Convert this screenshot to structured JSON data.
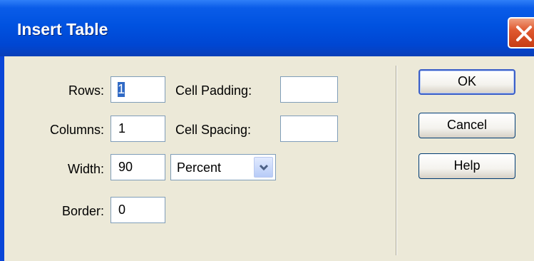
{
  "dialog": {
    "title": "Insert Table",
    "close_icon": "close-icon"
  },
  "form": {
    "rows": {
      "label": "Rows:",
      "value": "1"
    },
    "columns": {
      "label": "Columns:",
      "value": "1"
    },
    "width": {
      "label": "Width:",
      "value": "90",
      "unit": "Percent"
    },
    "border": {
      "label": "Border:",
      "value": "0"
    },
    "cell_padding": {
      "label": "Cell Padding:",
      "value": ""
    },
    "cell_spacing": {
      "label": "Cell Spacing:",
      "value": ""
    }
  },
  "buttons": {
    "ok": "OK",
    "cancel": "Cancel",
    "help": "Help"
  },
  "colors": {
    "titlebar": "#0052e0",
    "dialog_bg": "#ece9d8",
    "close_button": "#e05a30"
  }
}
